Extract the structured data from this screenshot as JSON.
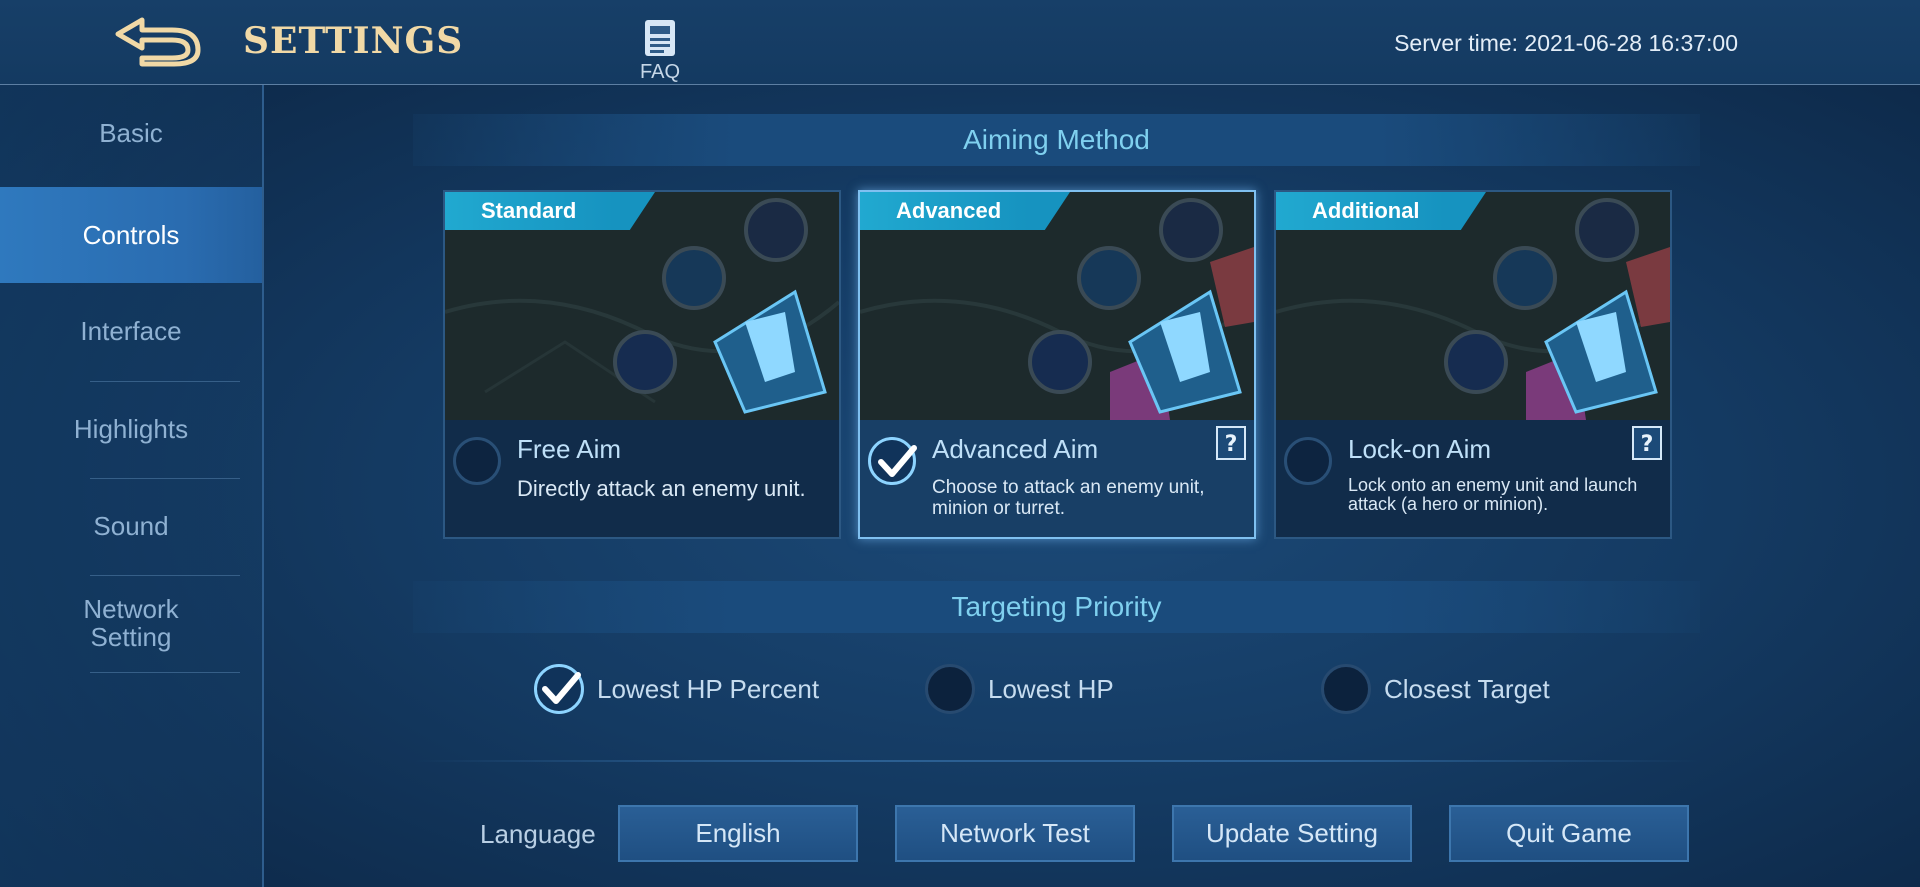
{
  "header": {
    "title": "SETTINGS",
    "faq_label": "FAQ",
    "server_time": "Server time: 2021-06-28 16:37:00"
  },
  "sidebar": {
    "items": [
      {
        "label": "Basic",
        "active": false
      },
      {
        "label": "Controls",
        "active": true
      },
      {
        "label": "Interface",
        "active": false
      },
      {
        "label": "Highlights",
        "active": false
      },
      {
        "label": "Sound",
        "active": false
      },
      {
        "label": "Network Setting",
        "active": false
      }
    ]
  },
  "aiming": {
    "title": "Aiming Method",
    "cards": [
      {
        "tag": "Standard",
        "name": "Free Aim",
        "desc": "Directly attack an enemy unit.",
        "selected": false
      },
      {
        "tag": "Advanced",
        "name": "Advanced Aim",
        "desc": "Choose to attack an enemy unit, minion or turret.",
        "selected": true
      },
      {
        "tag": "Additional",
        "name": "Lock-on Aim",
        "desc": "Lock onto an enemy unit and launch attack (a hero or minion).",
        "selected": false
      }
    ]
  },
  "targeting": {
    "title": "Targeting Priority",
    "options": [
      {
        "label": "Lowest HP Percent",
        "selected": true
      },
      {
        "label": "Lowest HP",
        "selected": false
      },
      {
        "label": "Closest Target",
        "selected": false
      }
    ]
  },
  "bottom": {
    "language_label": "Language",
    "language_value": "English",
    "network_test": "Network Test",
    "update_setting": "Update Setting",
    "quit_game": "Quit Game"
  },
  "colors": {
    "accent": "#7fd0ef",
    "title_gold": "#f1d9a6",
    "tag_cyan": "#21a9d0",
    "selected_border": "#7fc0f0"
  }
}
